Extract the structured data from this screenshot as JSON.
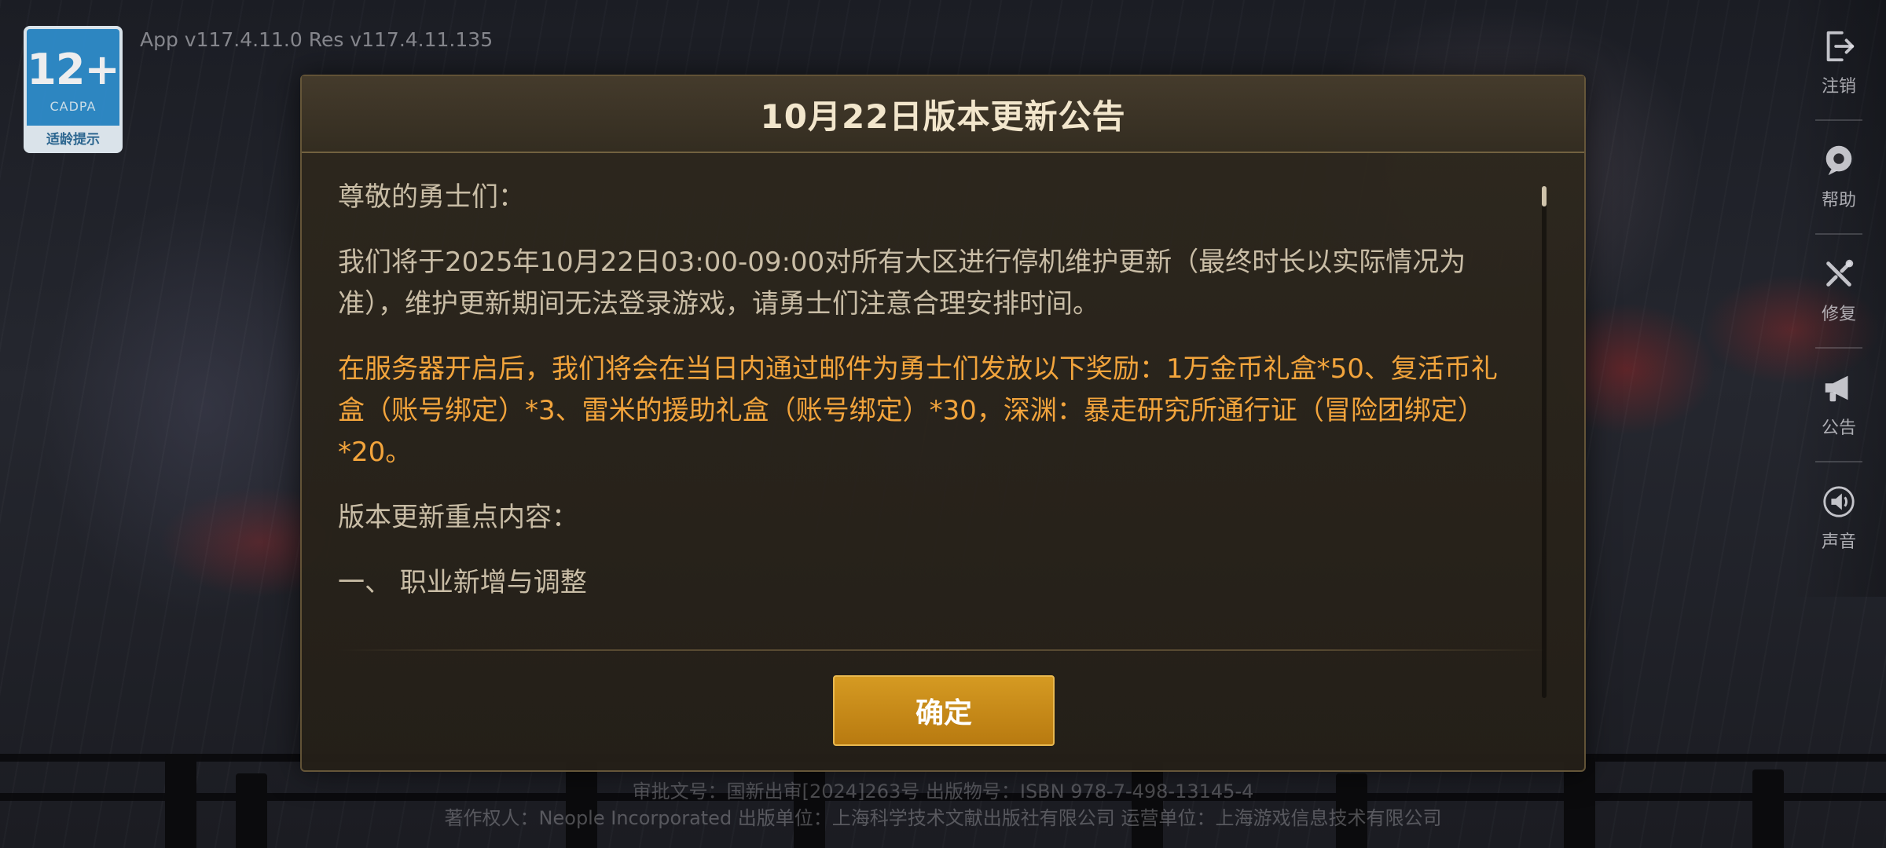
{
  "age_rating": {
    "number": "12+",
    "org": "CADPA",
    "note": "适龄提示"
  },
  "version_info": "App v117.4.11.0 Res v117.4.11.135",
  "sidebar": {
    "items": [
      {
        "label": "注销",
        "icon": "logout-icon"
      },
      {
        "label": "帮助",
        "icon": "help-icon"
      },
      {
        "label": "修复",
        "icon": "repair-icon"
      },
      {
        "label": "公告",
        "icon": "announcement-icon"
      },
      {
        "label": "声音",
        "icon": "sound-icon"
      }
    ]
  },
  "dialog": {
    "title": "10月22日版本更新公告",
    "paragraphs": {
      "greeting": "尊敬的勇士们：",
      "maintenance": "我们将于2025年10月22日03:00-09:00对所有大区进行停机维护更新（最终时长以实际情况为准），维护更新期间无法登录游戏，请勇士们注意合理安排时间。",
      "rewards": "在服务器开启后，我们将会在当日内通过邮件为勇士们发放以下奖励：1万金币礼盒*50、复活币礼盒（账号绑定）*3、雷米的援助礼盒（账号绑定）*30，深渊：暴走研究所通行证（冒险团绑定）*20。",
      "highlights_heading": "版本更新重点内容：",
      "section_one": "一、 职业新增与调整"
    },
    "confirm_label": "确定"
  },
  "legal": {
    "line1": "审批文号：国新出审[2024]263号 出版物号：ISBN 978-7-498-13145-4",
    "line2": "著作权人：Neople Incorporated 出版单位：上海科学技术文献出版社有限公司 运营单位：上海游戏信息技术有限公司"
  },
  "colors": {
    "accent": "#f2a43c",
    "button": "#c88a18",
    "text": "#c9bda6",
    "title": "#f2e6cc"
  }
}
